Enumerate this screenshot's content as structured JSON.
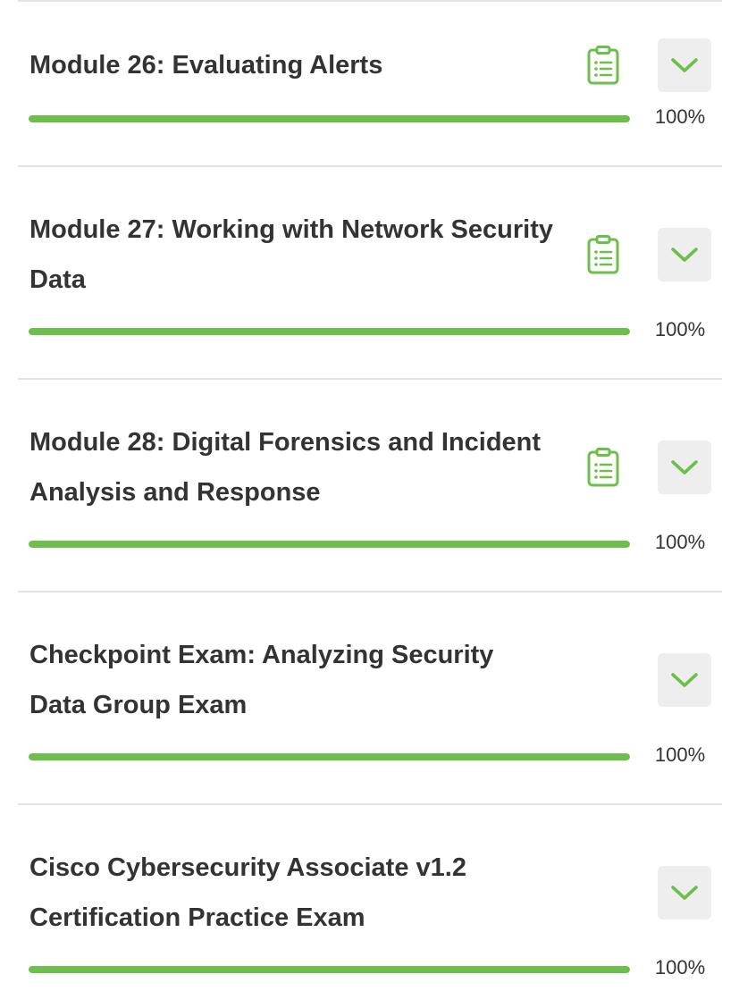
{
  "colors": {
    "accent_green": "#6cbf4a",
    "text": "#333333",
    "button_bg": "#eeeeee",
    "divider": "#e3e3e3"
  },
  "modules": [
    {
      "title": "Module 26: Evaluating Alerts",
      "progress_label": "100%",
      "progress_fraction": 1.0,
      "has_checklist_icon": true,
      "icon": "clipboard-checklist-icon",
      "toggle_icon": "chevron-down-icon"
    },
    {
      "title": "Module 27: Working with Network Security Data",
      "progress_label": "100%",
      "progress_fraction": 1.0,
      "has_checklist_icon": true,
      "icon": "clipboard-checklist-icon",
      "toggle_icon": "chevron-down-icon"
    },
    {
      "title": "Module 28: Digital Forensics and Incident Analysis and Response",
      "progress_label": "100%",
      "progress_fraction": 1.0,
      "has_checklist_icon": true,
      "icon": "clipboard-checklist-icon",
      "toggle_icon": "chevron-down-icon"
    },
    {
      "title": "Checkpoint Exam: Analyzing Security Data Group Exam",
      "progress_label": "100%",
      "progress_fraction": 1.0,
      "has_checklist_icon": false,
      "toggle_icon": "chevron-down-icon"
    },
    {
      "title": "Cisco Cybersecurity Associate v1.2 Certification Practice Exam",
      "progress_label": "100%",
      "progress_fraction": 1.0,
      "has_checklist_icon": false,
      "toggle_icon": "chevron-down-icon"
    }
  ]
}
